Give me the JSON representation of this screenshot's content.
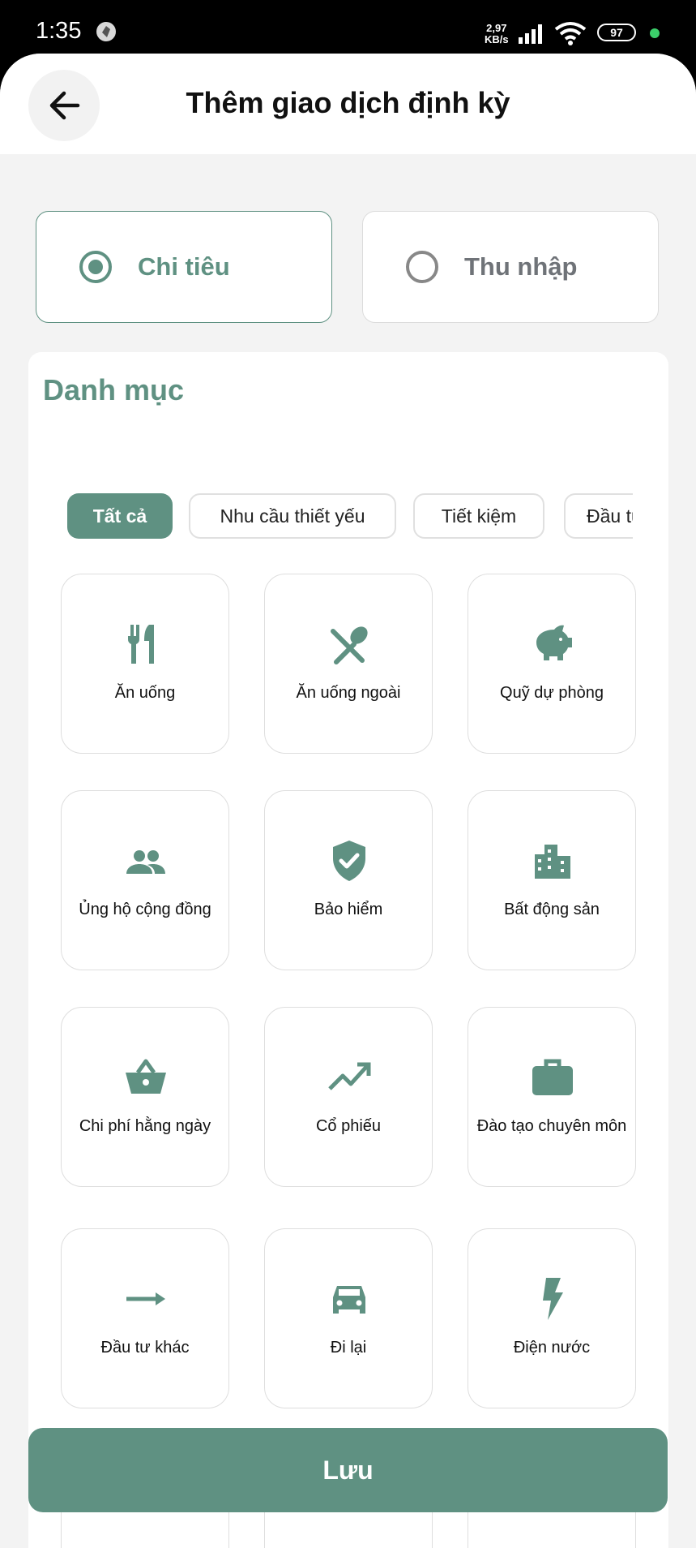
{
  "status_bar": {
    "time": "1:35",
    "speed_value": "2,97",
    "speed_unit": "KB/s",
    "battery": "97"
  },
  "header": {
    "title": "Thêm giao dịch định kỳ"
  },
  "type_selector": {
    "expense_label": "Chi tiêu",
    "income_label": "Thu nhập",
    "selected": "expense"
  },
  "category": {
    "title": "Danh mục",
    "chips": [
      "Tất cả",
      "Nhu cầu thiết yếu",
      "Tiết kiệm",
      "Đầu tư"
    ],
    "active_chip": "Tất cả",
    "items": [
      {
        "label": "Ăn uống",
        "icon": "restaurant-icon"
      },
      {
        "label": "Ăn uống ngoài",
        "icon": "dining-out-icon"
      },
      {
        "label": "Quỹ dự phòng",
        "icon": "piggy-bank-icon"
      },
      {
        "label": "Ủng hộ cộng đồng",
        "icon": "people-icon"
      },
      {
        "label": "Bảo hiểm",
        "icon": "shield-check-icon"
      },
      {
        "label": "Bất động sản",
        "icon": "building-icon"
      },
      {
        "label": "Chi phí hằng ngày",
        "icon": "basket-icon"
      },
      {
        "label": "Cổ phiếu",
        "icon": "trending-up-icon"
      },
      {
        "label": "Đào tạo chuyên môn",
        "icon": "briefcase-icon"
      },
      {
        "label": "Đầu tư khác",
        "icon": "arrow-right-icon"
      },
      {
        "label": "Đi lại",
        "icon": "car-icon"
      },
      {
        "label": "Điện nước",
        "icon": "lightning-icon"
      }
    ]
  },
  "colors": {
    "accent": "#5f9182",
    "background": "#f3f3f3",
    "card_border": "#dedede"
  },
  "save_label": "Lưu"
}
